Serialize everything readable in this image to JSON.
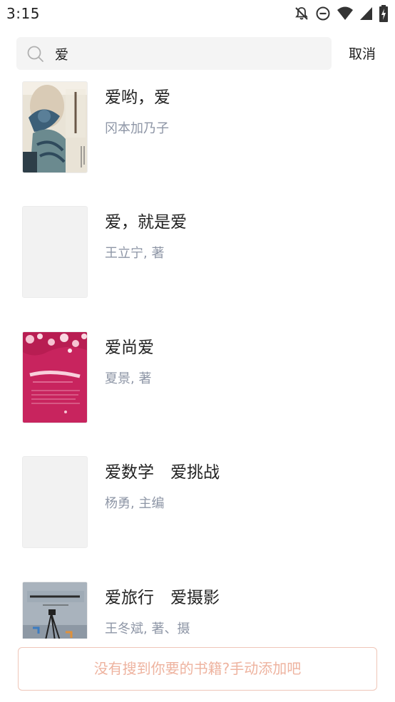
{
  "status_bar": {
    "time": "3:15",
    "icons": [
      "notifications-off-icon",
      "do-not-disturb-icon",
      "wifi-icon",
      "signal-icon",
      "battery-charging-icon"
    ]
  },
  "search": {
    "query": "爱",
    "icon": "search-icon",
    "cancel_label": "取消"
  },
  "results": [
    {
      "title": "爱哟，爱",
      "author": "冈本加乃子",
      "cover": "illustrated"
    },
    {
      "title": "爱，就是爱",
      "author": "王立宁, 著",
      "cover": "placeholder"
    },
    {
      "title": "爱尚爱",
      "author": "夏景, 著",
      "cover": "illustrated"
    },
    {
      "title": "爱数学　爱挑战",
      "author": "杨勇, 主编",
      "cover": "placeholder"
    },
    {
      "title": "爱旅行　爱摄影",
      "author": "王冬斌, 著、摄",
      "cover": "illustrated"
    }
  ],
  "footer": {
    "add_manually_label": "没有搜到你要的书籍?手动添加吧"
  },
  "colors": {
    "accent_border": "#efc6b8",
    "accent_text": "#eeb39f",
    "author_text": "#8e96a6",
    "search_bg": "#f4f4f4"
  }
}
